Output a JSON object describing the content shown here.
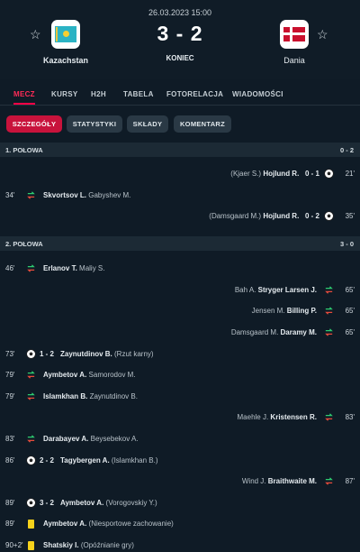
{
  "header": {
    "date": "26.03.2023 15:00",
    "home_team": "Kazachstan",
    "away_team": "Dania",
    "score": "3 - 2",
    "status": "KONIEC"
  },
  "tabs": [
    "MECZ",
    "KURSY",
    "H2H",
    "TABELA",
    "FOTORELACJA",
    "WIADOMOŚCI"
  ],
  "subtabs": [
    "SZCZEGÓŁY",
    "STATYSTYKI",
    "SKŁADY",
    "KOMENTARZ"
  ],
  "half1": {
    "label": "1. POŁOWA",
    "result": "0 - 2",
    "events": [
      {
        "side": "away",
        "type": "goal",
        "minute": "21'",
        "player": "Hojlund R.",
        "assist": "(Kjaer S.)",
        "score": "0 - 1"
      },
      {
        "side": "home",
        "type": "sub",
        "minute": "34'",
        "player": "Skvortsov L.",
        "other": "Gabyshev M."
      },
      {
        "side": "away",
        "type": "goal",
        "minute": "35'",
        "player": "Hojlund R.",
        "assist": "(Damsgaard M.)",
        "score": "0 - 2"
      }
    ]
  },
  "half2": {
    "label": "2. POŁOWA",
    "result": "3 - 0",
    "events": [
      {
        "side": "home",
        "type": "sub",
        "minute": "46'",
        "player": "Erlanov T.",
        "other": "Maliy S."
      },
      {
        "side": "away",
        "type": "sub",
        "minute": "65'",
        "player": "Stryger Larsen J.",
        "other": "Bah A."
      },
      {
        "side": "away",
        "type": "sub",
        "minute": "65'",
        "player": "Billing P.",
        "other": "Jensen M."
      },
      {
        "side": "away",
        "type": "sub",
        "minute": "65'",
        "player": "Daramy M.",
        "other": "Damsgaard M."
      },
      {
        "side": "home",
        "type": "goal",
        "minute": "73'",
        "score": "1 - 2",
        "player": "Zaynutdinov B.",
        "other": "(Rzut karny)"
      },
      {
        "side": "home",
        "type": "sub",
        "minute": "79'",
        "player": "Aymbetov A.",
        "other": "Samorodov M."
      },
      {
        "side": "home",
        "type": "sub",
        "minute": "79'",
        "player": "Islamkhan B.",
        "other": "Zaynutdinov B."
      },
      {
        "side": "away",
        "type": "sub",
        "minute": "83'",
        "player": "Kristensen R.",
        "other": "Maehle J."
      },
      {
        "side": "home",
        "type": "sub",
        "minute": "83'",
        "player": "Darabayev A.",
        "other": "Beysebekov A."
      },
      {
        "side": "home",
        "type": "goal",
        "minute": "86'",
        "score": "2 - 2",
        "player": "Tagybergen A.",
        "other": "(Islamkhan B.)"
      },
      {
        "side": "away",
        "type": "sub",
        "minute": "87'",
        "player": "Braithwaite M.",
        "other": "Wind J."
      },
      {
        "side": "home",
        "type": "goal",
        "minute": "89'",
        "score": "3 - 2",
        "player": "Aymbetov A.",
        "other": "(Vorogovskiy Y.)"
      },
      {
        "side": "home",
        "type": "yellow",
        "minute": "89'",
        "player": "Aymbetov A.",
        "other": "(Niesportowe zachowanie)"
      },
      {
        "side": "home",
        "type": "yellow",
        "minute": "90+2'",
        "player": "Shatskiy I.",
        "other": "(Opóźnianie gry)"
      }
    ]
  },
  "colors": {
    "accent": "#ff0046",
    "background": "#0f1b26",
    "section": "#1c2a35"
  },
  "icons": {
    "favorite": "star-icon",
    "goal": "soccer-ball-icon",
    "sub": "substitution-icon",
    "yellow": "yellow-card-icon"
  }
}
